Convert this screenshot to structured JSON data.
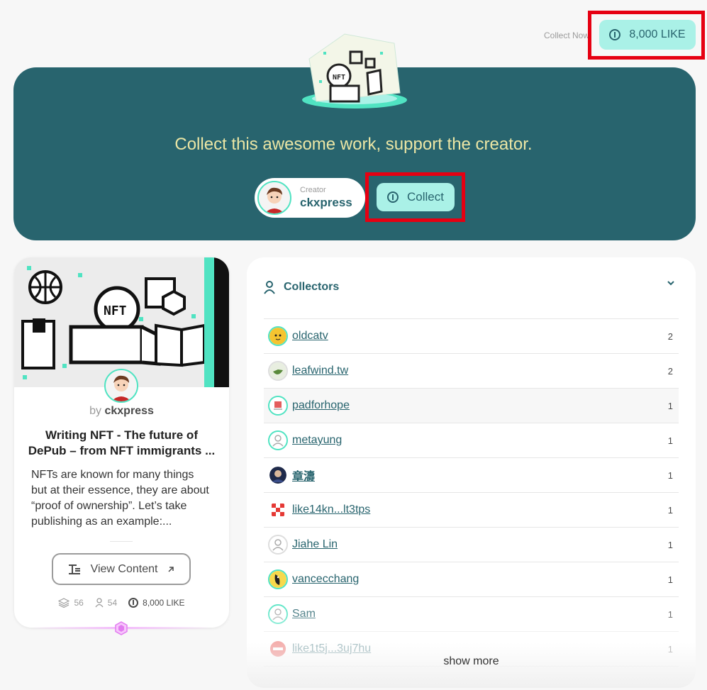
{
  "top": {
    "collect_now_label": "Collect Now",
    "price_label": "8,000 LIKE"
  },
  "hero": {
    "headline": "Collect this awesome work, support the creator.",
    "creator_caption": "Creator",
    "creator_name": "ckxpress",
    "collect_label": "Collect"
  },
  "card": {
    "by_prefix": "by",
    "author": "ckxpress",
    "title": "Writing NFT - The future of DePub – from NFT immigrants ...",
    "description": "NFTs are known for many things but at their essence, they are about “proof of ownership”. Let’s take publishing as an example:...",
    "view_label": "View Content",
    "stats": {
      "editions": "56",
      "collectors": "54",
      "price": "8,000 LIKE"
    }
  },
  "collectors": {
    "title": "Collectors",
    "rows": [
      {
        "name": "oldcatv",
        "count": "2",
        "avatar": "cat-avatar-icon"
      },
      {
        "name": "leafwind.tw",
        "count": "2",
        "avatar": "bird-avatar-icon"
      },
      {
        "name": "padforhope",
        "count": "1",
        "avatar": "pad-avatar-icon"
      },
      {
        "name": "metayung",
        "count": "1",
        "avatar": "default-avatar-icon"
      },
      {
        "name": "章濤",
        "count": "1",
        "avatar": "person-avatar-icon"
      },
      {
        "name": "like14kn...lt3tps",
        "count": "1",
        "avatar": "pattern-avatar-icon"
      },
      {
        "name": "Jiahe Lin",
        "count": "1",
        "avatar": "default-avatar-icon"
      },
      {
        "name": "vancecchang",
        "count": "1",
        "avatar": "bird-avatar-icon"
      },
      {
        "name": "Sam",
        "count": "1",
        "avatar": "default-avatar-icon"
      },
      {
        "name": "like1t5j...3uj7hu",
        "count": "1",
        "avatar": "blocked-avatar-icon"
      }
    ],
    "show_more": "show more"
  },
  "colors": {
    "brand": "#28646e",
    "accent": "#aaf1e7",
    "headline": "#ebe6a5",
    "highlight_box": "#e60012"
  }
}
